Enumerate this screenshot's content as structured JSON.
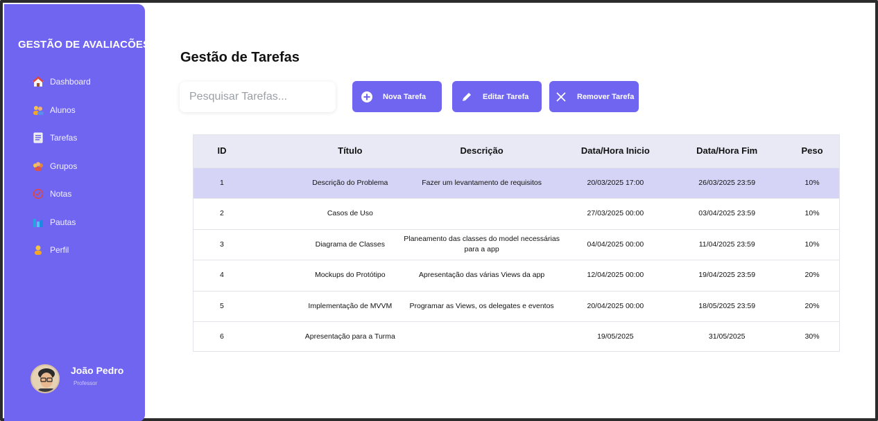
{
  "sidebar": {
    "brand": "GESTÃO DE AVALIACÕES",
    "items": [
      {
        "label": "Dashboard",
        "icon": "house-icon"
      },
      {
        "label": "Alunos",
        "icon": "students-icon"
      },
      {
        "label": "Tarefas",
        "icon": "clipboard-icon"
      },
      {
        "label": "Grupos",
        "icon": "group-icon"
      },
      {
        "label": "Notas",
        "icon": "grades-icon"
      },
      {
        "label": "Pautas",
        "icon": "bar-chart-icon"
      },
      {
        "label": "Perfil",
        "icon": "person-icon"
      }
    ],
    "user": {
      "name": "João Pedro",
      "role": "Professor"
    }
  },
  "main": {
    "title": "Gestão de Tarefas",
    "search": {
      "placeholder": "Pesquisar Tarefas..."
    },
    "buttons": {
      "new": "Nova Tarefa",
      "edit": "Editar Tarefa",
      "remove": "Remover Tarefa"
    },
    "table": {
      "headers": [
        "ID",
        "Título",
        "Descrição",
        "Data/Hora Inicio",
        "Data/Hora Fim",
        "Peso"
      ],
      "rows": [
        {
          "id": "1",
          "title": "Descrição do Problema",
          "desc": "Fazer um levantamento de requisitos",
          "start": "20/03/2025 17:00",
          "end": "26/03/2025 23:59",
          "weight": "10%"
        },
        {
          "id": "2",
          "title": "Casos de Uso",
          "desc": "",
          "start": "27/03/2025 00:00",
          "end": "03/04/2025 23:59",
          "weight": "10%"
        },
        {
          "id": "3",
          "title": "Diagrama de Classes",
          "desc": "Planeamento das classes do model necessárias para a app",
          "start": "04/04/2025 00:00",
          "end": "11/04/2025 23:59",
          "weight": "10%"
        },
        {
          "id": "4",
          "title": "Mockups do Protótipo",
          "desc": "Apresentação das várias Views da app",
          "start": "12/04/2025 00:00",
          "end": "19/04/2025 23:59",
          "weight": "20%"
        },
        {
          "id": "5",
          "title": "Implementação de MVVM",
          "desc": "Programar as Views, os delegates e eventos",
          "start": "20/04/2025 00:00",
          "end": "18/05/2025 23:59",
          "weight": "20%"
        },
        {
          "id": "6",
          "title": "Apresentação para a Turma",
          "desc": "",
          "start": "19/05/2025",
          "end": "31/05/2025",
          "weight": "30%"
        }
      ]
    }
  },
  "colors": {
    "accent": "#7065f0",
    "header_bg": "#e9e9f6",
    "selected_row": "#d6d4f6"
  }
}
